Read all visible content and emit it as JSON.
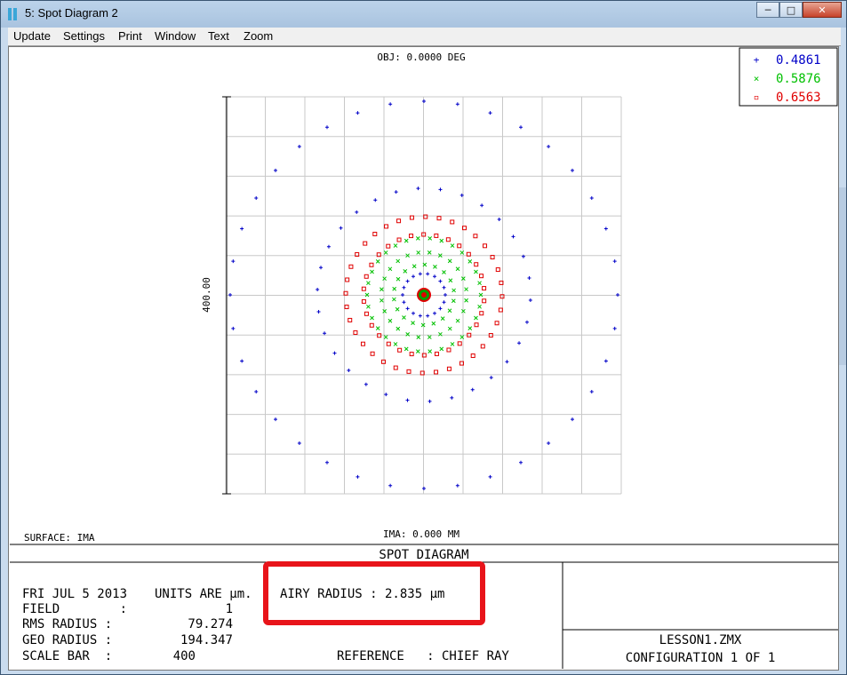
{
  "window": {
    "title": "5: Spot Diagram 2",
    "minimize": "─",
    "maximize": "□",
    "close": "✕",
    "icon": "app-icon"
  },
  "menu": [
    "Update",
    "Settings",
    "Print",
    "Window",
    "Text",
    "Zoom"
  ],
  "plot": {
    "object_label": "OBJ: 0.0000 DEG",
    "image_label": "IMA: 0.000 MM",
    "surface_label": "SURFACE: IMA",
    "scale_label": "400.00",
    "title": "SPOT DIAGRAM"
  },
  "legend": [
    {
      "symbol": "+",
      "label": "0.4861",
      "color": "#0000c8"
    },
    {
      "symbol": "×",
      "label": "0.5876",
      "color": "#00c000"
    },
    {
      "symbol": "▫",
      "label": "0.6563",
      "color": "#e00000"
    }
  ],
  "info": {
    "date": "FRI JUL 5 2013",
    "units": "UNITS ARE µm.",
    "airy": "AIRY RADIUS : 2.835 µm",
    "field_label": "FIELD        :",
    "field_value": "1",
    "rms_label": "RMS RADIUS :",
    "rms_value": "79.274",
    "geo_label": "GEO RADIUS :",
    "geo_value": "194.347",
    "scale_label": "SCALE BAR  :",
    "scale_value": "400",
    "reference": "REFERENCE   : CHIEF RAY",
    "file": "LESSON1.ZMX",
    "config": "CONFIGURATION 1 OF 1"
  },
  "highlight_color": "#e8141a"
}
